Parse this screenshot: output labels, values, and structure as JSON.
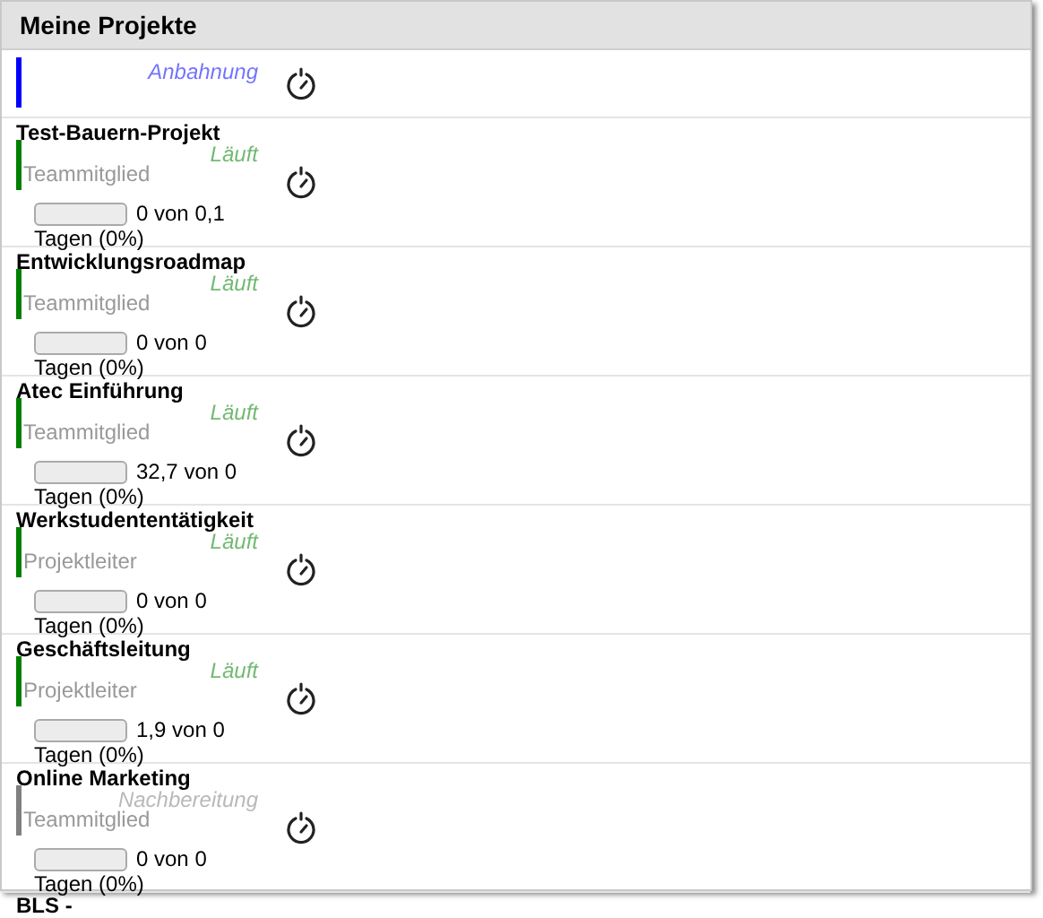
{
  "panel": {
    "title": "Meine Projekte"
  },
  "projects": [
    {
      "status": "Anbahnung",
      "color": "#0000ff"
    },
    {
      "title": "Test-Bauern-Projekt",
      "status": "Läuft",
      "color": "#008000",
      "role": "Teammitglied",
      "level": 0,
      "reading": "0 von 0,1",
      "days": "Tagen (0%)"
    },
    {
      "title": "Entwicklungsroadmap",
      "status": "Läuft",
      "color": "#008000",
      "role": "Teammitglied",
      "level": 0,
      "reading": "0 von 0",
      "days": "Tagen (0%)"
    },
    {
      "title": "Atec Einführung",
      "status": "Läuft",
      "color": "#008000",
      "role": "Teammitglied",
      "level": 0,
      "reading": "32,7 von 0",
      "days": "Tagen (0%)"
    },
    {
      "title": "Werkstudententätigkeit",
      "status": "Läuft",
      "color": "#008000",
      "role": "Projektleiter",
      "level": 0,
      "reading": "0 von 0",
      "days": "Tagen (0%)"
    },
    {
      "title": "Geschäftsleitung",
      "status": "Läuft",
      "color": "#008000",
      "role": "Projektleiter",
      "level": 0,
      "reading": "1,9 von 0",
      "days": "Tagen (0%)"
    },
    {
      "title": "Online Marketing",
      "status": "Nachbereitung",
      "color": "#808080",
      "role": "Teammitglied",
      "level": 0,
      "reading": "0 von 0",
      "days": "Tagen (0%)"
    }
  ],
  "next_title": "BLS -"
}
